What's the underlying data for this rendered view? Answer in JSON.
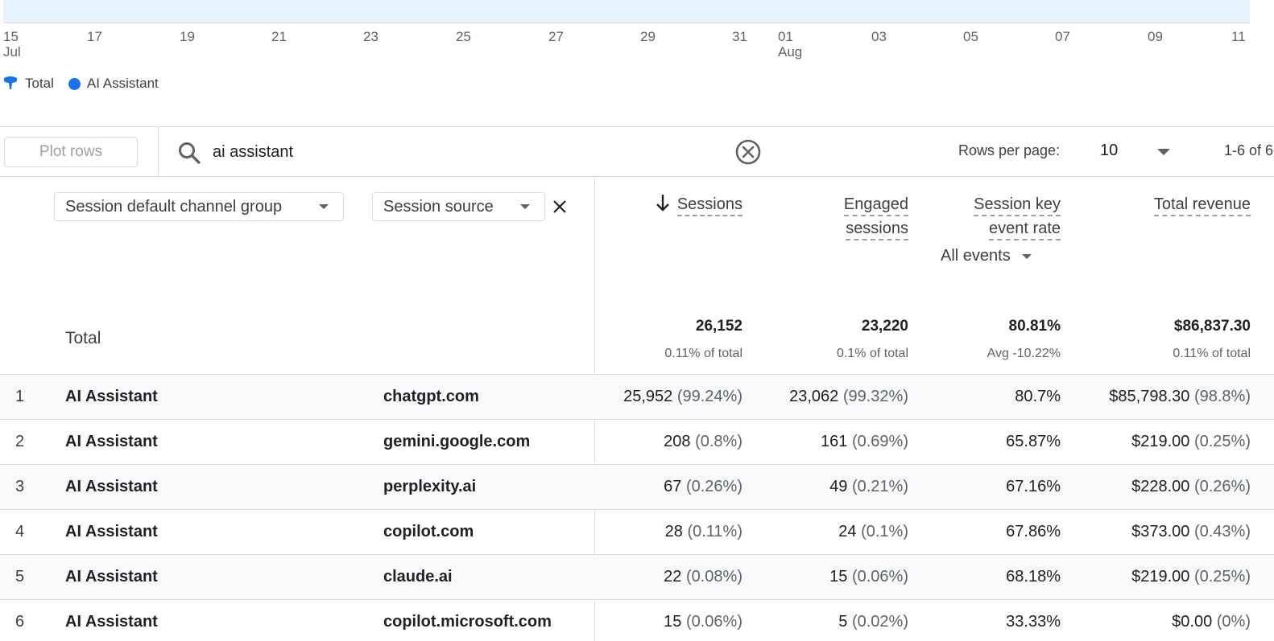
{
  "chart": {
    "ticks": [
      {
        "label": "15",
        "sub": "Jul"
      },
      {
        "label": "17",
        "sub": ""
      },
      {
        "label": "19",
        "sub": ""
      },
      {
        "label": "21",
        "sub": ""
      },
      {
        "label": "23",
        "sub": ""
      },
      {
        "label": "25",
        "sub": ""
      },
      {
        "label": "27",
        "sub": ""
      },
      {
        "label": "29",
        "sub": ""
      },
      {
        "label": "31",
        "sub": ""
      },
      {
        "label": "01",
        "sub": "Aug"
      },
      {
        "label": "03",
        "sub": ""
      },
      {
        "label": "05",
        "sub": ""
      },
      {
        "label": "07",
        "sub": ""
      },
      {
        "label": "09",
        "sub": ""
      },
      {
        "label": "11",
        "sub": ""
      }
    ],
    "legend": {
      "total": "Total",
      "ai_assistant": "AI Assistant"
    },
    "colors": {
      "band": "#e8f3fd",
      "total_pin": "#1a73e8",
      "ai_dot": "#1a73e8"
    }
  },
  "toolbar": {
    "plot_rows": "Plot rows",
    "search_value": "ai assistant",
    "rows_per_page_label": "Rows per page:",
    "rows_per_page_value": "10",
    "page_range": "1-6 of 6"
  },
  "table": {
    "dimension_1": "Session default channel group",
    "dimension_2": "Session source",
    "metrics": {
      "sessions": "Sessions",
      "engaged_line1": "Engaged",
      "engaged_line2": "sessions",
      "keyrate_line1": "Session key",
      "keyrate_line2": "event rate",
      "keyrate_filter": "All events",
      "revenue": "Total revenue"
    },
    "totals": {
      "label": "Total",
      "sessions": "26,152",
      "sessions_sub": "0.11% of total",
      "engaged": "23,220",
      "engaged_sub": "0.1% of total",
      "keyrate": "80.81%",
      "keyrate_sub": "Avg -10.22%",
      "revenue": "$86,837.30",
      "revenue_sub": "0.11% of total"
    },
    "rows": [
      {
        "idx": "1",
        "channel": "AI Assistant",
        "source": "chatgpt.com",
        "sessions": "25,952",
        "sessions_pct": "(99.24%)",
        "engaged": "23,062",
        "engaged_pct": "(99.32%)",
        "rate": "80.7%",
        "revenue": "$85,798.30",
        "revenue_pct": "(98.8%)"
      },
      {
        "idx": "2",
        "channel": "AI Assistant",
        "source": "gemini.google.com",
        "sessions": "208",
        "sessions_pct": "(0.8%)",
        "engaged": "161",
        "engaged_pct": "(0.69%)",
        "rate": "65.87%",
        "revenue": "$219.00",
        "revenue_pct": "(0.25%)"
      },
      {
        "idx": "3",
        "channel": "AI Assistant",
        "source": "perplexity.ai",
        "sessions": "67",
        "sessions_pct": "(0.26%)",
        "engaged": "49",
        "engaged_pct": "(0.21%)",
        "rate": "67.16%",
        "revenue": "$228.00",
        "revenue_pct": "(0.26%)"
      },
      {
        "idx": "4",
        "channel": "AI Assistant",
        "source": "copilot.com",
        "sessions": "28",
        "sessions_pct": "(0.11%)",
        "engaged": "24",
        "engaged_pct": "(0.1%)",
        "rate": "67.86%",
        "revenue": "$373.00",
        "revenue_pct": "(0.43%)"
      },
      {
        "idx": "5",
        "channel": "AI Assistant",
        "source": "claude.ai",
        "sessions": "22",
        "sessions_pct": "(0.08%)",
        "engaged": "15",
        "engaged_pct": "(0.06%)",
        "rate": "68.18%",
        "revenue": "$219.00",
        "revenue_pct": "(0.25%)"
      },
      {
        "idx": "6",
        "channel": "AI Assistant",
        "source": "copilot.microsoft.com",
        "sessions": "15",
        "sessions_pct": "(0.06%)",
        "engaged": "5",
        "engaged_pct": "(0.02%)",
        "rate": "33.33%",
        "revenue": "$0.00",
        "revenue_pct": "(0%)"
      }
    ]
  }
}
